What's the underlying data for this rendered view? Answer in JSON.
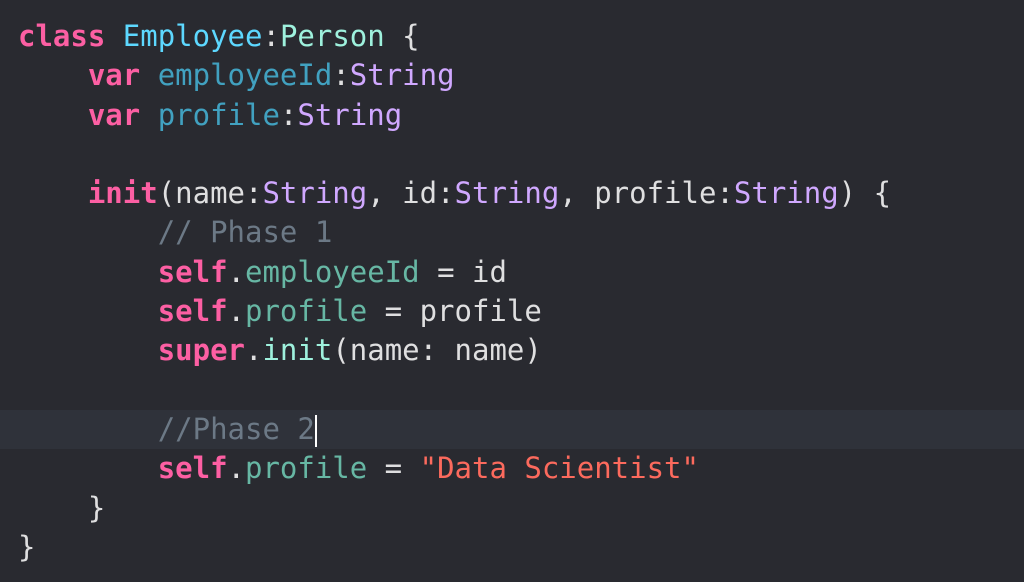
{
  "editor": {
    "language": "Swift",
    "current_line": 11,
    "lines": [
      {
        "tokens": [
          {
            "t": "class",
            "c": "kw"
          },
          {
            "t": " ",
            "c": "plain"
          },
          {
            "t": "Employee",
            "c": "typedecl"
          },
          {
            "t": ":",
            "c": "plain"
          },
          {
            "t": "Person",
            "c": "typeother"
          },
          {
            "t": " {",
            "c": "plain"
          }
        ]
      },
      {
        "tokens": [
          {
            "t": "    ",
            "c": "plain"
          },
          {
            "t": "var",
            "c": "kw"
          },
          {
            "t": " ",
            "c": "plain"
          },
          {
            "t": "employeeId",
            "c": "propdecl"
          },
          {
            "t": ":",
            "c": "plain"
          },
          {
            "t": "String",
            "c": "type"
          }
        ]
      },
      {
        "tokens": [
          {
            "t": "    ",
            "c": "plain"
          },
          {
            "t": "var",
            "c": "kw"
          },
          {
            "t": " ",
            "c": "plain"
          },
          {
            "t": "profile",
            "c": "propdecl"
          },
          {
            "t": ":",
            "c": "plain"
          },
          {
            "t": "String",
            "c": "type"
          }
        ]
      },
      {
        "tokens": []
      },
      {
        "tokens": [
          {
            "t": "    ",
            "c": "plain"
          },
          {
            "t": "init",
            "c": "kw"
          },
          {
            "t": "(name:",
            "c": "plain"
          },
          {
            "t": "String",
            "c": "type"
          },
          {
            "t": ", id:",
            "c": "plain"
          },
          {
            "t": "String",
            "c": "type"
          },
          {
            "t": ", profile:",
            "c": "plain"
          },
          {
            "t": "String",
            "c": "type"
          },
          {
            "t": ") {",
            "c": "plain"
          }
        ]
      },
      {
        "tokens": [
          {
            "t": "        ",
            "c": "plain"
          },
          {
            "t": "// Phase 1",
            "c": "comment"
          }
        ]
      },
      {
        "tokens": [
          {
            "t": "        ",
            "c": "plain"
          },
          {
            "t": "self",
            "c": "kw"
          },
          {
            "t": ".",
            "c": "plain"
          },
          {
            "t": "employeeId",
            "c": "member"
          },
          {
            "t": " = id",
            "c": "plain"
          }
        ]
      },
      {
        "tokens": [
          {
            "t": "        ",
            "c": "plain"
          },
          {
            "t": "self",
            "c": "kw"
          },
          {
            "t": ".",
            "c": "plain"
          },
          {
            "t": "profile",
            "c": "member"
          },
          {
            "t": " = profile",
            "c": "plain"
          }
        ]
      },
      {
        "tokens": [
          {
            "t": "        ",
            "c": "plain"
          },
          {
            "t": "super",
            "c": "kw"
          },
          {
            "t": ".",
            "c": "plain"
          },
          {
            "t": "init",
            "c": "func"
          },
          {
            "t": "(name: name)",
            "c": "plain"
          }
        ]
      },
      {
        "tokens": []
      },
      {
        "tokens": [
          {
            "t": "        ",
            "c": "plain"
          },
          {
            "t": "//Phase 2",
            "c": "comment"
          }
        ]
      },
      {
        "tokens": [
          {
            "t": "        ",
            "c": "plain"
          },
          {
            "t": "self",
            "c": "kw"
          },
          {
            "t": ".",
            "c": "plain"
          },
          {
            "t": "profile",
            "c": "member"
          },
          {
            "t": " = ",
            "c": "plain"
          },
          {
            "t": "\"Data Scientist\"",
            "c": "str"
          }
        ]
      },
      {
        "tokens": [
          {
            "t": "    }",
            "c": "plain"
          }
        ]
      },
      {
        "tokens": [
          {
            "t": "}",
            "c": "plain"
          }
        ]
      }
    ]
  }
}
